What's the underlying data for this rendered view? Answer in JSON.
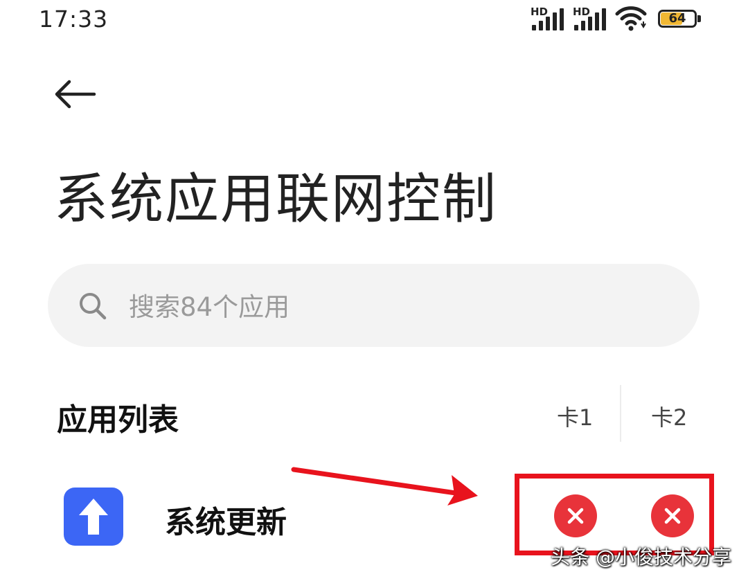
{
  "status_bar": {
    "time": "17:33",
    "sim1_badge": "HD",
    "sim2_badge": "HD",
    "battery_level": "64",
    "battery_fill_percent": 64,
    "battery_color": "#f0b733"
  },
  "header": {
    "back_icon": "arrow-left-icon",
    "title": "系统应用联网控制"
  },
  "search": {
    "icon": "search-icon",
    "placeholder": "搜索84个应用"
  },
  "list": {
    "section_title": "应用列表",
    "columns": [
      "卡1",
      "卡2"
    ],
    "items": [
      {
        "name": "系统更新",
        "icon": "arrow-up-icon",
        "icon_color": "#3c66f5",
        "sim1_allowed": false,
        "sim2_allowed": false,
        "toggle_color": "#e8333a"
      }
    ]
  },
  "annotation": {
    "color": "#e8131d"
  },
  "watermark": "头条 @小俊技术分享"
}
